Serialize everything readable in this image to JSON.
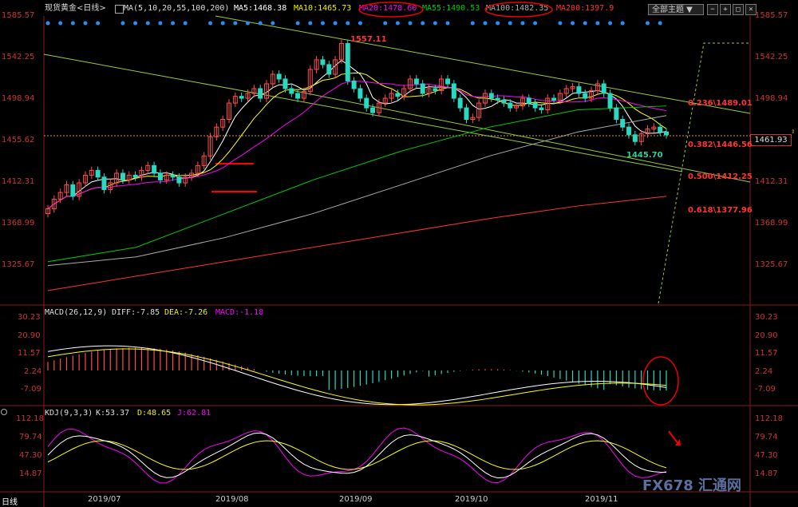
{
  "header": {
    "instrument": "现货黄金<日线>",
    "ma_params": "MA(5,10,20,55,100,200)",
    "ma5": "MA5:1468.38",
    "ma10": "MA10:1465.73",
    "ma20": "MA20:1478.60",
    "ma55": "MA55:1490.53",
    "ma100": "MA100:1482.35",
    "ma200": "MA200:1397.9",
    "theme_selector": "全部主题",
    "colors": {
      "ma5": "#ffffff",
      "ma10": "#ffff00",
      "ma20": "#ff00ff",
      "ma55": "#00cc00",
      "ma100": "#aaaaaa",
      "ma200": "#ff3333"
    }
  },
  "price_panel": {
    "y_ticks": [
      "1585.57",
      "1542.25",
      "1498.94",
      "1455.62",
      "1412.31",
      "1368.99",
      "1325.67"
    ],
    "current_price": "1461.93",
    "high_label": "1557.11",
    "low_label": "1445.70",
    "fib_levels": [
      {
        "label": "0.236\\1489.01",
        "value": 1489.01
      },
      {
        "label": "0.382\\1446.56",
        "value": 1446.56
      },
      {
        "label": "0.500\\1412.25",
        "value": 1412.25
      },
      {
        "label": "0.618\\1377.96",
        "value": 1377.96
      }
    ]
  },
  "macd_panel": {
    "title": "MACD(26,12,9)",
    "diff": "DIFF:-7.85",
    "dea": "DEA:-7.26",
    "macd": "MACD:-1.18",
    "y_ticks": [
      "30.23",
      "20.90",
      "11.57",
      "2.24",
      "-7.09"
    ]
  },
  "kdj_panel": {
    "title": "KDJ(9,3,3)",
    "k": "K:53.37",
    "d": "D:48.65",
    "j": "J:62.81",
    "y_ticks": [
      "112.18",
      "79.74",
      "47.30",
      "14.87"
    ]
  },
  "x_axis": {
    "period_label": "日线",
    "months": [
      "2019/07",
      "2019/08",
      "2019/09",
      "2019/10",
      "2019/11"
    ]
  },
  "watermark": "FX678 汇通网",
  "chart_data": {
    "type": "candlestick",
    "title": "现货黄金<日线>",
    "ylim": [
      1325.67,
      1585.57
    ],
    "x": [
      "2019/07",
      "2019/08",
      "2019/09",
      "2019/10",
      "2019/11"
    ],
    "closes": [
      1385,
      1395,
      1402,
      1410,
      1398,
      1412,
      1420,
      1425,
      1418,
      1405,
      1412,
      1422,
      1415,
      1420,
      1418,
      1425,
      1430,
      1422,
      1415,
      1420,
      1418,
      1412,
      1418,
      1422,
      1430,
      1440,
      1460,
      1470,
      1478,
      1495,
      1502,
      1500,
      1505,
      1510,
      1500,
      1515,
      1525,
      1520,
      1510,
      1505,
      1500,
      1507,
      1530,
      1540,
      1535,
      1525,
      1540,
      1557,
      1518,
      1510,
      1500,
      1490,
      1485,
      1495,
      1500,
      1505,
      1502,
      1510,
      1520,
      1515,
      1505,
      1510,
      1508,
      1520,
      1515,
      1500,
      1490,
      1478,
      1480,
      1495,
      1505,
      1500,
      1498,
      1495,
      1490,
      1492,
      1500,
      1495,
      1490,
      1488,
      1500,
      1498,
      1505,
      1510,
      1512,
      1505,
      1500,
      1508,
      1515,
      1505,
      1490,
      1478,
      1470,
      1462,
      1455,
      1463,
      1468,
      1470,
      1465,
      1462
    ]
  }
}
